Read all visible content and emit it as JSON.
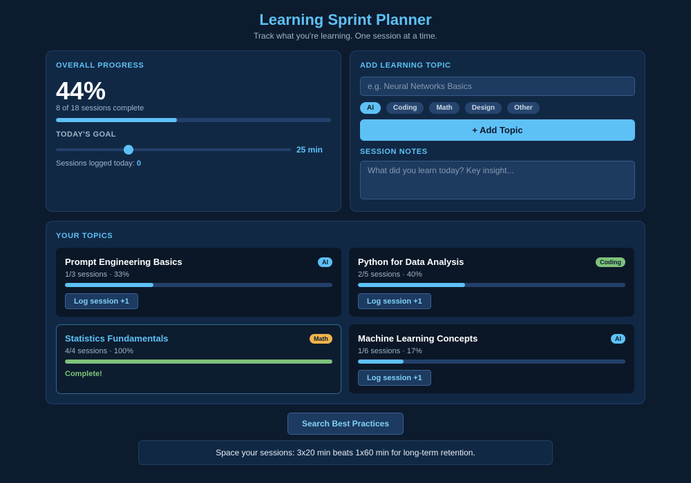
{
  "header": {
    "title": "Learning Sprint Planner",
    "subtitle": "Track what you're learning. One session at a time."
  },
  "progress": {
    "label": "OVERALL PROGRESS",
    "percent_text": "44%",
    "percent": 44,
    "sessions_text": "8 of 18 sessions complete",
    "goal_label": "TODAY'S GOAL",
    "goal_value": "25 min",
    "goal_fraction": 0.31,
    "logged_label": "Sessions logged today:",
    "logged_count": "0"
  },
  "add_topic": {
    "label": "ADD LEARNING TOPIC",
    "placeholder": "e.g. Neural Networks Basics",
    "chips": [
      "AI",
      "Coding",
      "Math",
      "Design",
      "Other"
    ],
    "active_chip": "AI",
    "add_button": "+ Add Topic",
    "notes_label": "SESSION NOTES",
    "notes_placeholder": "What did you learn today? Key insight..."
  },
  "topics": {
    "label": "YOUR TOPICS",
    "items": [
      {
        "title": "Prompt Engineering Basics",
        "badge": "AI",
        "badge_color": "#5ec1f5",
        "meta": "1/3 sessions · 33%",
        "percent": 33,
        "action": "Log session +1"
      },
      {
        "title": "Python for Data Analysis",
        "badge": "Coding",
        "badge_color": "#7ec27a",
        "meta": "2/5 sessions · 40%",
        "percent": 40,
        "action": "Log session +1"
      },
      {
        "title": "Statistics Fundamentals",
        "badge": "Math",
        "badge_color": "#f0b54a",
        "meta": "4/4 sessions · 100%",
        "percent": 100,
        "action": "Complete!"
      },
      {
        "title": "Machine Learning Concepts",
        "badge": "AI",
        "badge_color": "#5ec1f5",
        "meta": "1/6 sessions · 17%",
        "percent": 17,
        "action": "Log session +1"
      }
    ]
  },
  "search_button": "Search Best Practices",
  "tip": "Space your sessions: 3x20 min beats 1x60 min for long-term retention.",
  "colors": {
    "accent": "#5ec1f5",
    "background": "#0d1b2e",
    "complete": "#7ec27a"
  }
}
